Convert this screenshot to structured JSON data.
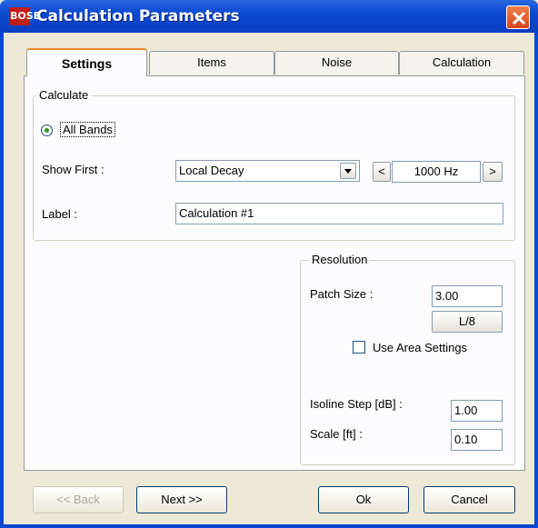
{
  "window": {
    "title": "Calculation Parameters",
    "app_icon_text": "BOSE"
  },
  "tabs": [
    {
      "label": "Settings",
      "selected": true
    },
    {
      "label": "Items"
    },
    {
      "label": "Noise"
    },
    {
      "label": "Calculation"
    }
  ],
  "calculate": {
    "legend": "Calculate",
    "radio_label": "All Bands",
    "show_first_label": "Show First :",
    "show_first_value": "Local Decay",
    "freq_prev": "<",
    "freq_value": "1000 Hz",
    "freq_next": ">",
    "label_label": "Label :",
    "label_value": "Calculation #1"
  },
  "resolution": {
    "legend": "Resolution",
    "patch_size_label": "Patch Size :",
    "patch_size_value": "3.00",
    "fraction_button": "L/8",
    "use_area_label": "Use Area Settings",
    "use_area_checked": false,
    "isoline_label": "Isoline Step [dB] :",
    "isoline_value": "1.00",
    "scale_label": "Scale [ft] :",
    "scale_value": "0.10"
  },
  "buttons": {
    "back": "<< Back",
    "next": "Next >>",
    "ok": "Ok",
    "cancel": "Cancel"
  }
}
